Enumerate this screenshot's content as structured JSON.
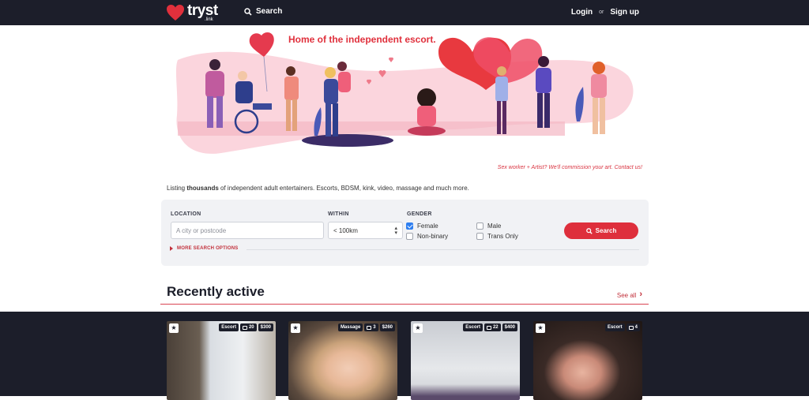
{
  "nav": {
    "logo_text": "tryst",
    "logo_sub": ".link",
    "search_label": "Search",
    "login_label": "Login",
    "or_label": "or",
    "signup_label": "Sign up"
  },
  "hero": {
    "tagline": "Home of the independent escort.",
    "commission_text": "Sex worker + Artist? We'll commission your art. Contact us!"
  },
  "listing": {
    "prefix": "Listing ",
    "bold": "thousands",
    "suffix": " of independent adult entertainers. Escorts, BDSM, kink, video, massage and much more."
  },
  "search_panel": {
    "location_label": "LOCATION",
    "location_placeholder": "A city or postcode",
    "within_label": "WITHIN",
    "within_value": "< 100km",
    "gender_label": "GENDER",
    "genders": [
      {
        "label": "Female",
        "checked": true
      },
      {
        "label": "Non-binary",
        "checked": false
      },
      {
        "label": "Male",
        "checked": false
      },
      {
        "label": "Trans Only",
        "checked": false
      }
    ],
    "search_button": "Search",
    "more_options": "MORE SEARCH OPTIONS"
  },
  "recently_active": {
    "title": "Recently active",
    "see_all": "See all",
    "cards": [
      {
        "type": "Escort",
        "photos": "20",
        "price": "$300"
      },
      {
        "type": "Massage",
        "photos": "3",
        "price": "$260"
      },
      {
        "type": "Escort",
        "photos": "22",
        "price": "$400"
      },
      {
        "type": "Escort",
        "photos": "4",
        "price": ""
      }
    ]
  },
  "colors": {
    "nav_bg": "#1c1e2a",
    "accent": "#de2f3c",
    "panel_bg": "#f1f2f5"
  }
}
